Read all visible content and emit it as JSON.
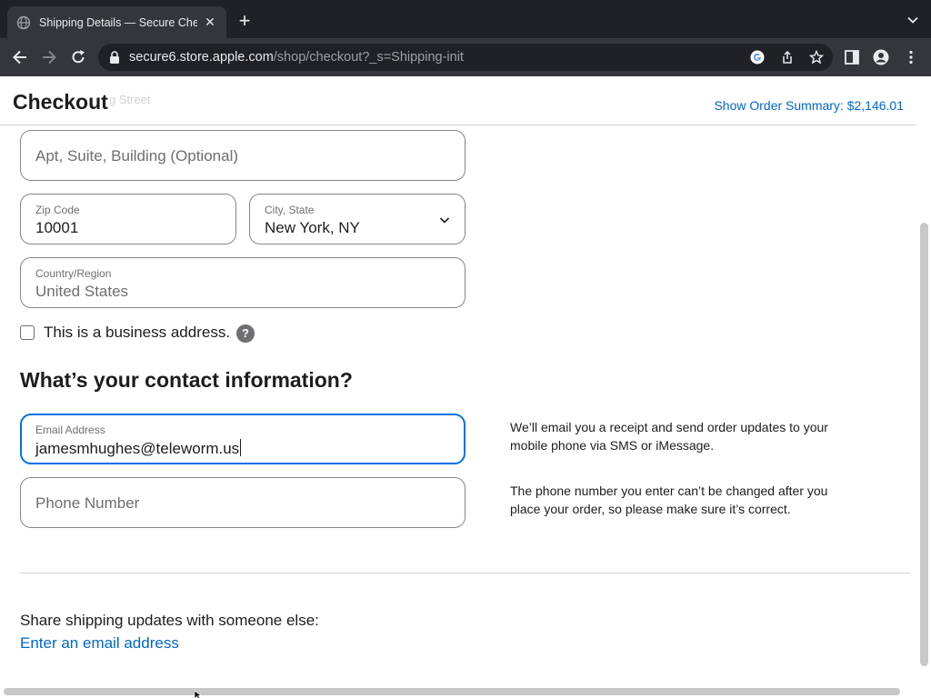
{
  "browser": {
    "tab_title": "Shipping Details — Secure Che",
    "url_host": "secure6.store.apple.com",
    "url_path": "/shop/checkout?_s=Shipping-init"
  },
  "header": {
    "title": "Checkout",
    "ghost_text": "g Street",
    "order_summary": "Show Order Summary: $2,146.01"
  },
  "address": {
    "apt_placeholder": "Apt, Suite, Building (Optional)",
    "zip_label": "Zip Code",
    "zip_value": "10001",
    "city_label": "City, State",
    "city_value": "New York, NY",
    "country_label": "Country/Region",
    "country_value": "United States",
    "business_label": "This is a business address.",
    "business_checked": false,
    "help_glyph": "?"
  },
  "contact": {
    "heading": "What’s your contact information?",
    "email_label": "Email Address",
    "email_value": "jamesmhughes@teleworm.us",
    "phone_placeholder": "Phone Number",
    "email_note": "We’ll email you a receipt and send order updates to your mobile phone via SMS or iMessage.",
    "phone_note": "The phone number you enter can’t be changed after you place your order, so please make sure it’s correct."
  },
  "share": {
    "text": "Share shipping updates with someone else:",
    "link": "Enter an email address"
  },
  "colors": {
    "link": "#0066cc",
    "focus": "#0071e3",
    "browser_dark": "#202124",
    "browser_toolbar": "#35363a"
  },
  "icons": [
    "globe-icon",
    "close-icon",
    "plus-icon",
    "chevron-down-icon",
    "back-icon",
    "forward-icon",
    "reload-icon",
    "lock-icon",
    "google-icon",
    "share-icon",
    "star-icon",
    "sidepanel-icon",
    "profile-icon",
    "more-icon"
  ]
}
